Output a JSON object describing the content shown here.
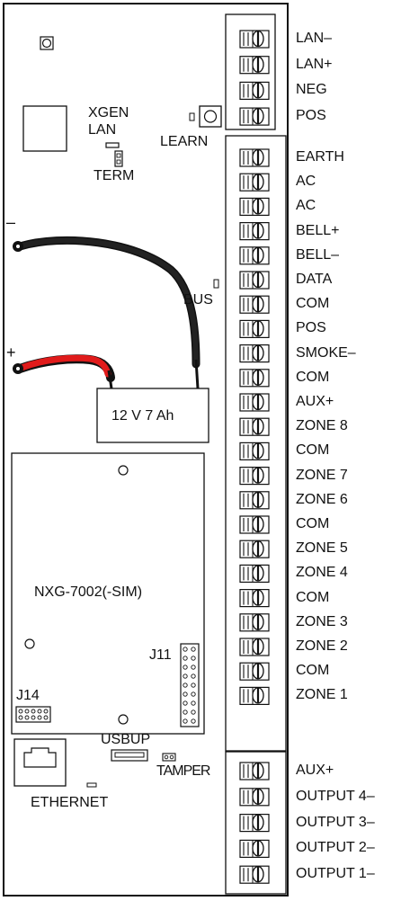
{
  "board_labels": {
    "xgen": "XGEN",
    "lan": "LAN",
    "term": "TERM",
    "learn": "LEARN",
    "bus": "BUS",
    "battery": "12 V 7 Ah",
    "battery_neg": "–",
    "battery_pos": "+",
    "module": "NXG-7002(-SIM)",
    "j11": "J11",
    "j14": "J14",
    "usbup": "USBUP",
    "tamper": "TAMPER",
    "ethernet": "ETHERNET"
  },
  "terminal_blocks": {
    "top": [
      "LAN–",
      "LAN+",
      "NEG",
      "POS"
    ],
    "middle": [
      "EARTH",
      "AC",
      "AC",
      "BELL+",
      "BELL–",
      "DATA",
      "COM",
      "POS",
      "SMOKE–",
      "COM",
      "AUX+",
      "ZONE 8",
      "COM",
      "ZONE 7",
      "ZONE 6",
      "COM",
      "ZONE 5",
      "ZONE 4",
      "COM",
      "ZONE 3",
      "ZONE 2",
      "COM",
      "ZONE 1"
    ],
    "bottom": [
      "AUX+",
      "OUTPUT 4–",
      "OUTPUT 3–",
      "OUTPUT 2–",
      "OUTPUT 1–"
    ]
  },
  "colors": {
    "wire_negative": "#222222",
    "wire_positive": "#e01b1b",
    "outline": "#111111"
  }
}
